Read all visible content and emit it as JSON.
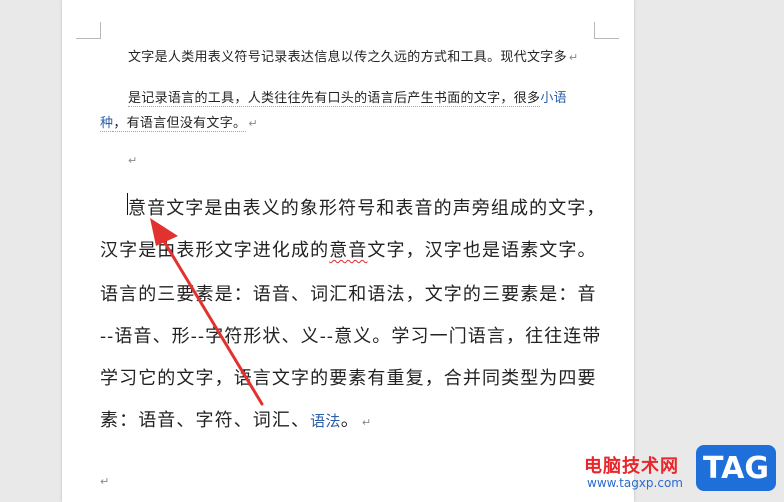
{
  "document": {
    "para1": {
      "line1": "文字是人类用表义符号记录表达信息以传之久远的方式和工具。现代文字多",
      "line2_a": "是记录语言的工具，人类往往先有口头的语言后产生书面的文字，很多",
      "line2_link": "小语",
      "line3_link": "种",
      "line3_b": "，有语言但没有文字。"
    },
    "para2": {
      "line1": "意音文字是由表义的象形符号和表音的声旁组成的文字，",
      "line2_a": "汉字是由表形文字进化成的",
      "line2_wavy": "意音",
      "line2_b": "文字，汉字也是语素文字。",
      "line3": "语言的三要素是：语音、词汇和语法，文字的三要素是：音",
      "line4": "--语音、形--字符形状、义--意义。学习一门语言，往往连带",
      "line5": "学习它的文字，语言文字的要素有重复，合并同类型为四要",
      "line6_a": "素：语音、字符、词汇、",
      "line6_link": "语法",
      "line6_b": "。"
    },
    "paragraph_mark": "↵"
  },
  "watermark": {
    "site_name": "电脑技术网",
    "url": "www.tagxp.com",
    "tag": "TAG"
  },
  "colors": {
    "arrow": "#e1322f",
    "link": "#2a5ea8"
  }
}
